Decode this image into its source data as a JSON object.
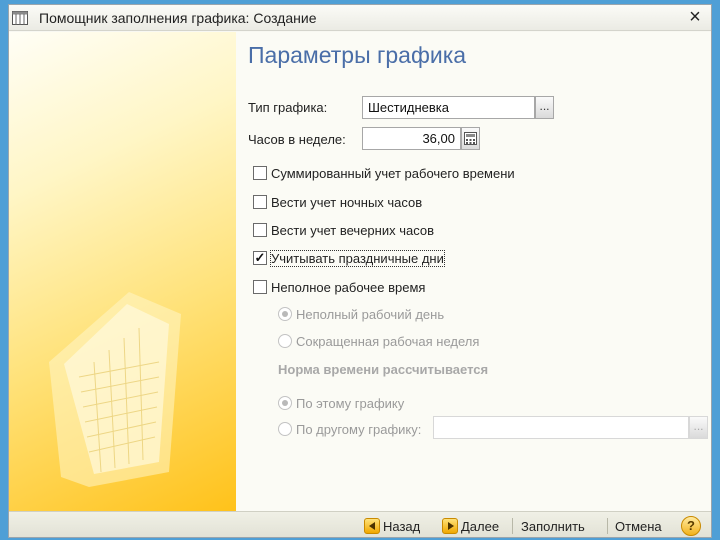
{
  "window": {
    "title": "Помощник заполнения графика: Создание",
    "close_glyph": "×",
    "icon": "calendar-icon"
  },
  "content": {
    "heading": "Параметры графика",
    "schedule_type": {
      "label": "Тип графика:",
      "value": "Шестидневка",
      "button": "..."
    },
    "hours_per_week": {
      "label": "Часов в неделе:",
      "value": "36,00",
      "button_icon": "calculator-icon"
    },
    "checkboxes": [
      {
        "label": "Суммированный учет рабочего времени",
        "checked": false
      },
      {
        "label": "Вести учет ночных часов",
        "checked": false
      },
      {
        "label": "Вести учет вечерних часов",
        "checked": false
      },
      {
        "label": "Учитывать праздничные дни",
        "checked": true
      },
      {
        "label": "Неполное рабочее время",
        "checked": false
      }
    ],
    "part_time_options": [
      {
        "label": "Неполный рабочий день",
        "selected": true,
        "enabled": false
      },
      {
        "label": "Сокращенная рабочая неделя",
        "selected": false,
        "enabled": false
      }
    ],
    "norm_section_label": "Норма времени рассчитывается",
    "norm_options": [
      {
        "label": "По этому графику",
        "selected": true,
        "enabled": false
      },
      {
        "label": "По другому графику:",
        "selected": false,
        "enabled": false
      }
    ],
    "other_schedule": {
      "value": "",
      "button": "..."
    }
  },
  "footer": {
    "back": "Назад",
    "next": "Далее",
    "fill": "Заполнить",
    "cancel": "Отмена",
    "help": "?"
  },
  "colors": {
    "heading": "#4a6ea8",
    "accent_yellow": "#ffc21a",
    "disabled_text": "#9a9a9a",
    "desktop": "#4f9fd6"
  }
}
